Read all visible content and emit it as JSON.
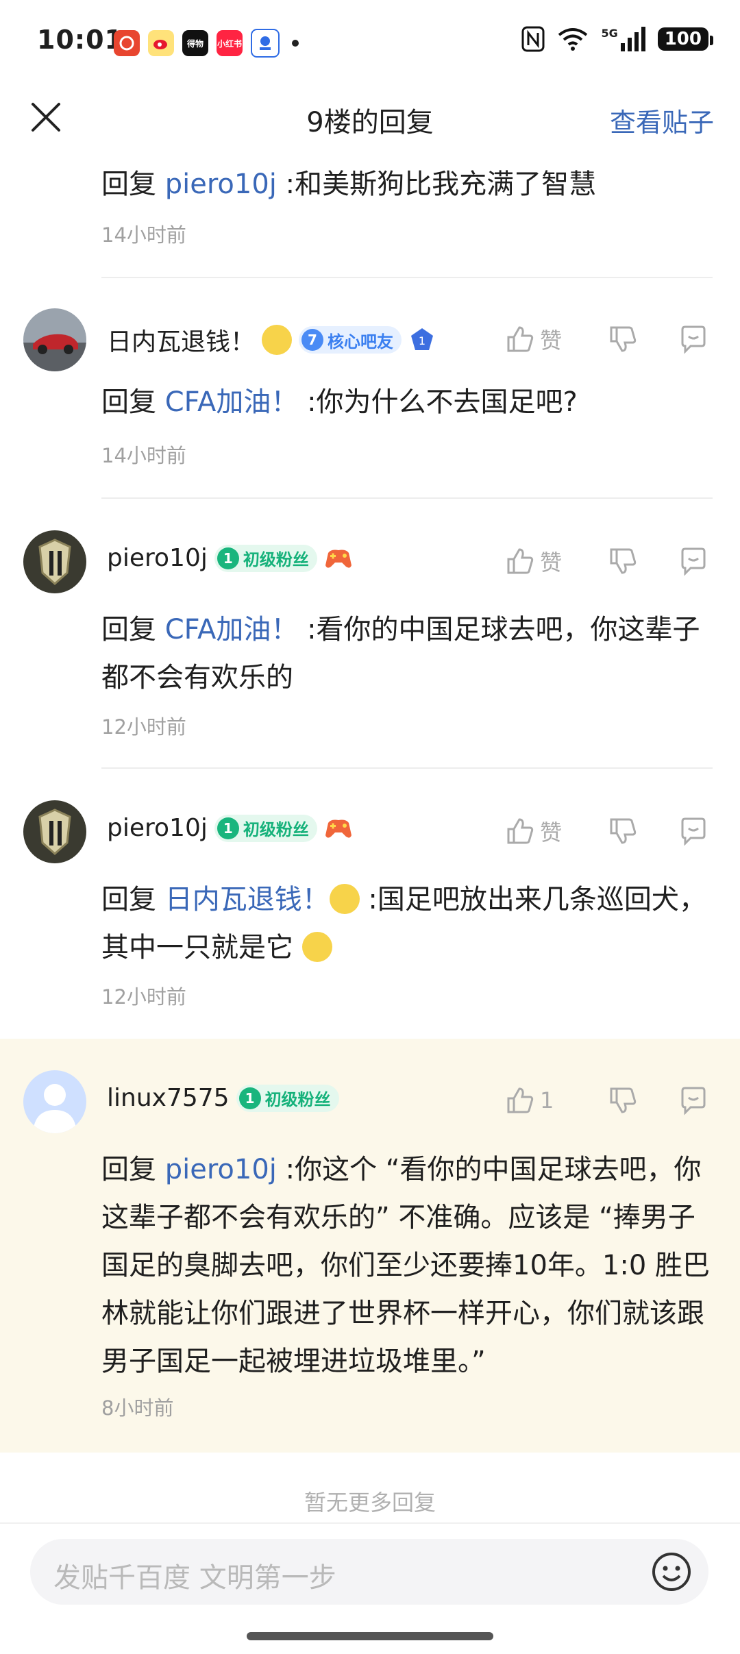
{
  "status": {
    "time": "10:01",
    "battery": "100",
    "signal": "5G"
  },
  "status_apps": [
    {
      "label": "",
      "color": "#e8452f"
    },
    {
      "label": "",
      "color": "#f7b500"
    },
    {
      "label": "得物",
      "color": "#111111"
    },
    {
      "label": "小红书",
      "color": "#ff2442"
    },
    {
      "label": "",
      "color": "#2f6ce5"
    }
  ],
  "header": {
    "title": "9楼的回复",
    "view_post": "查看贴子"
  },
  "top_reply": {
    "prefix": "回复 ",
    "mention": "piero10j",
    "text": " :和美斯狗比我充满了智慧",
    "time": "14小时前"
  },
  "posts": [
    {
      "user": "日内瓦退钱！",
      "badge_level": "7",
      "badge_text": "核心吧友",
      "extra_badge": "1",
      "like_label": "赞",
      "prefix": "回复 ",
      "mention": "CFA加油！",
      "text": "   :你为什么不去国足吧?",
      "time": "14小时前"
    },
    {
      "user": "piero10j",
      "badge_level": "1",
      "badge_text": "初级粉丝",
      "like_label": "赞",
      "prefix": "回复 ",
      "mention": "CFA加油！",
      "text": "   :看你的中国足球去吧，你这辈子都不会有欢乐的",
      "time": "12小时前"
    },
    {
      "user": "piero10j",
      "badge_level": "1",
      "badge_text": "初级粉丝",
      "like_label": "赞",
      "prefix": "回复 ",
      "mention": "日内瓦退钱！",
      "text_a": " :国足吧放出来几条巡回犬，其中一只就是它 ",
      "time": "12小时前"
    },
    {
      "user": "linux7575",
      "badge_level": "1",
      "badge_text": "初级粉丝",
      "like_label": "1",
      "prefix": "回复 ",
      "mention": "piero10j",
      "text": " :你这个 “看你的中国足球去吧，你这辈子都不会有欢乐的” 不准确。应该是 “捧男子国足的臭脚去吧，你们至少还要捧10年。1:0 胜巴林就能让你们跟进了世界杯一样开心，你们就该跟男子国足一起被埋进垃圾堆里。”",
      "time": "8小时前"
    }
  ],
  "footer": {
    "no_more": "暂无更多回复",
    "input_placeholder": "发贴千百度 文明第一步"
  },
  "colors": {
    "link": "#3a68b8",
    "highlight_bg": "#fcf8ea",
    "fan_badge": "#19b57d",
    "core_badge": "#4a8bf5"
  }
}
